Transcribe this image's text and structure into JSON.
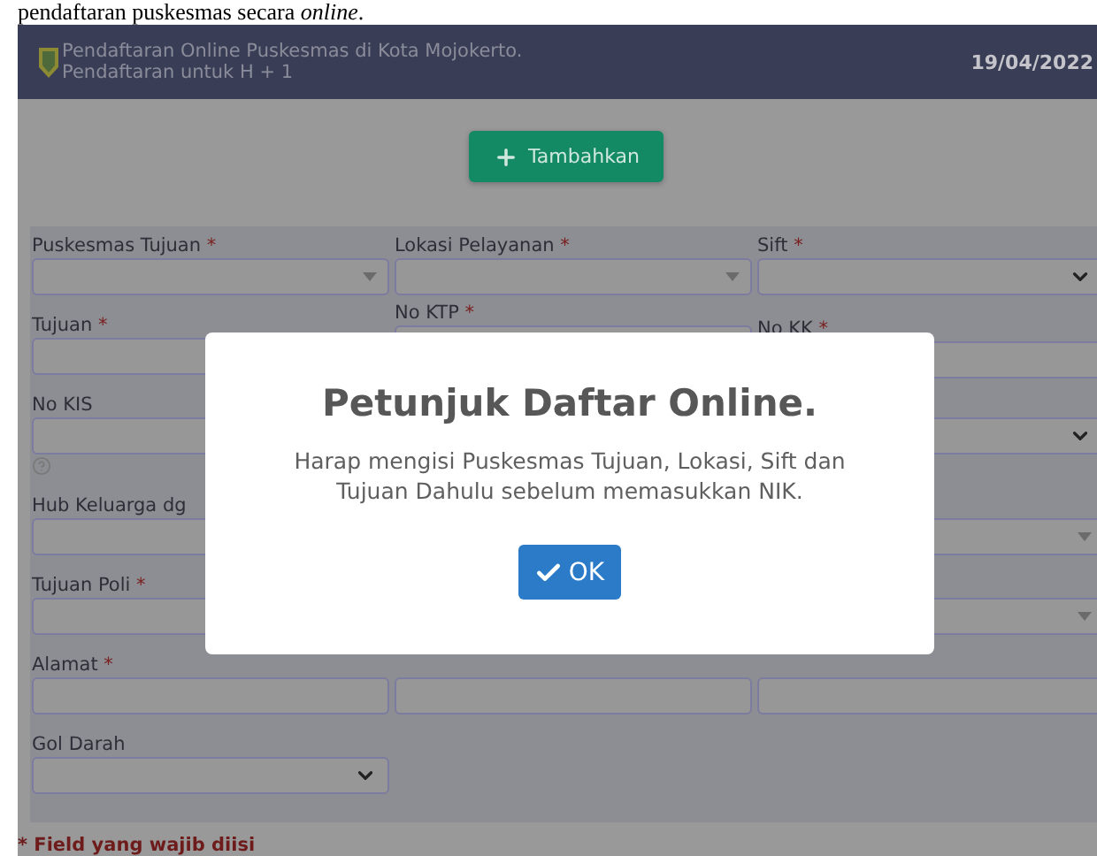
{
  "caption": "pendaftaran puskesmas secara *online*.",
  "header": {
    "title": "Pendaftaran Online Puskesmas di Kota Mojokerto.",
    "subtitle": "Pendaftaran untuk H + 1",
    "date": "19/04/2022"
  },
  "add_button": {
    "label": "Tambahkan"
  },
  "form": {
    "rows": [
      {
        "cells": [
          {
            "label": "Puskesmas Tujuan",
            "required_mark": "*",
            "kind": "combo"
          },
          {
            "label": "Lokasi Pelayanan",
            "required_mark": "*",
            "kind": "combo"
          },
          {
            "label": "Sift",
            "required_mark": "*",
            "kind": "dropdown"
          }
        ]
      },
      {
        "cells": [
          {
            "label": "Tujuan",
            "required_mark": "*",
            "kind": "text"
          },
          {
            "label": "No KTP",
            "required_mark": "*",
            "kind": "text"
          },
          {
            "label": "No KK",
            "required_mark": "*",
            "kind": "text"
          }
        ]
      },
      {
        "cells": [
          {
            "label": "No KIS",
            "kind": "text",
            "help": true
          },
          null,
          {
            "kind": "dropdown"
          }
        ]
      },
      {
        "cells": [
          {
            "label": "Hub Keluarga dg",
            "kind": "text"
          },
          null,
          {
            "kind": "combo"
          }
        ]
      },
      {
        "cells": [
          {
            "label": "Tujuan Poli",
            "required_mark": "*",
            "kind": "text"
          },
          null,
          {
            "kind": "combo"
          }
        ]
      },
      {
        "cells": [
          {
            "label": "Alamat",
            "required_mark": "*",
            "kind": "text"
          },
          {
            "kind": "text"
          },
          {
            "kind": "text"
          }
        ]
      },
      {
        "cells": [
          {
            "label": "Gol Darah",
            "kind": "dropdown"
          },
          null,
          null
        ]
      }
    ]
  },
  "required_note": "* Field yang wajib diisi",
  "dialog": {
    "title": "Petunjuk Daftar Online.",
    "message": "Harap mengisi Puskesmas Tujuan, Lokasi, Sift dan Tujuan Dahulu sebelum memasukkan NIK.",
    "ok_button": "OK"
  }
}
